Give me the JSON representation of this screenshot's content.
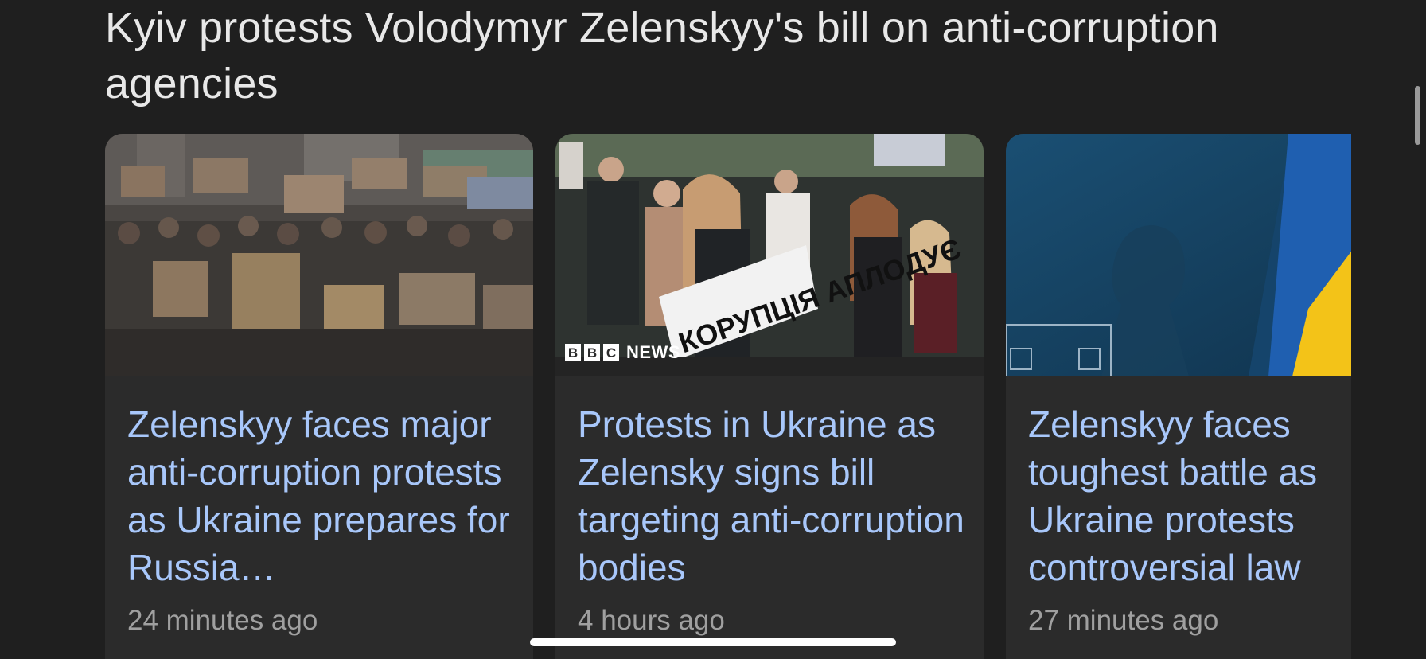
{
  "topic": {
    "title": "Kyiv protests Volodymyr Zelenskyy's bill on anti-corruption agencies"
  },
  "cards": [
    {
      "headline": "Zelenskyy faces major anti-corruption protests as Ukraine prepares for Russia…",
      "time": "24 minutes ago",
      "image": "protest-crowd-with-cardboard-signs"
    },
    {
      "headline": "Protests in Ukraine as Zelensky signs bill targeting anti-corruption bodies",
      "time": "4 hours ago",
      "image": "woman-shouting-holding-sign",
      "image_sign_text": "КОРУПЦІЯ АПЛОДУЄ",
      "source_logo": {
        "letters": [
          "B",
          "B",
          "C"
        ],
        "word": "NEWS"
      }
    },
    {
      "headline": "Zelenskyy faces toughest battle as Ukraine protests controversial law",
      "time": "27 minutes ago",
      "image": "silhouette-before-ukrainian-flag"
    }
  ],
  "colors": {
    "background": "#1f1f1f",
    "card": "#2b2b2b",
    "headline": "#a8c7fa",
    "title": "#e8e8e8",
    "meta": "#a0a0a0",
    "flag_blue": "#1f5fb0",
    "flag_yellow": "#f3c318"
  }
}
